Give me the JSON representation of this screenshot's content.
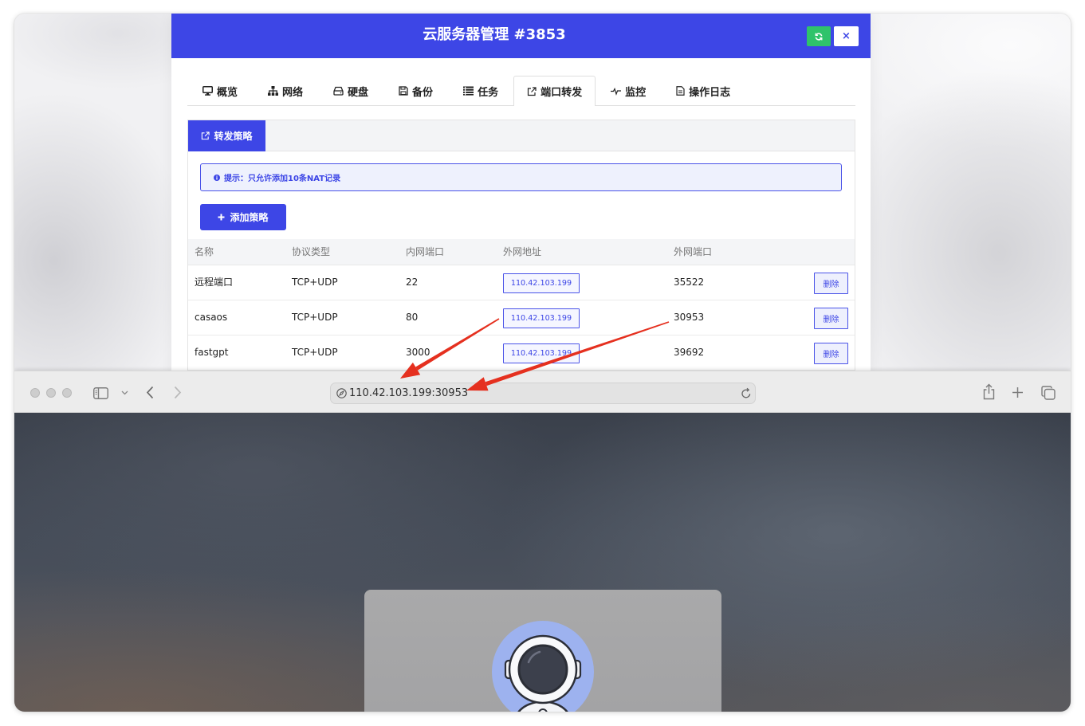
{
  "window": {
    "title": "云服务器管理 #3853",
    "refresh_icon": "refresh-icon",
    "close_label": "×"
  },
  "tabs": [
    {
      "label": "概览",
      "icon": "monitor-icon"
    },
    {
      "label": "网络",
      "icon": "sitemap-icon"
    },
    {
      "label": "硬盘",
      "icon": "hdd-icon"
    },
    {
      "label": "备份",
      "icon": "save-icon"
    },
    {
      "label": "任务",
      "icon": "tasks-icon"
    },
    {
      "label": "端口转发",
      "icon": "external-link-icon",
      "active": true
    },
    {
      "label": "监控",
      "icon": "heartbeat-icon"
    },
    {
      "label": "操作日志",
      "icon": "file-text-icon"
    }
  ],
  "forwarding": {
    "section_tab": {
      "label": "转发策略",
      "icon": "external-link-icon"
    },
    "notice": {
      "icon": "info-icon",
      "text": "提示：只允许添加10条NAT记录"
    },
    "add_button": {
      "icon": "plus-icon",
      "label": "添加策略"
    },
    "table": {
      "columns": [
        "名称",
        "协议类型",
        "内网端口",
        "外网地址",
        "外网端口"
      ],
      "rows": [
        {
          "name": "远程端口",
          "protocol": "TCP+UDP",
          "internal_port": "22",
          "external_address": "110.42.103.199",
          "external_port": "35522",
          "action": "删除"
        },
        {
          "name": "casaos",
          "protocol": "TCP+UDP",
          "internal_port": "80",
          "external_address": "110.42.103.199",
          "external_port": "30953",
          "action": "删除"
        },
        {
          "name": "fastgpt",
          "protocol": "TCP+UDP",
          "internal_port": "3000",
          "external_address": "110.42.103.199",
          "external_port": "39692",
          "action": "删除"
        }
      ]
    }
  },
  "browser": {
    "url": "110.42.103.199:30953",
    "icons": [
      "sidebar-icon",
      "chevron-down-icon",
      "back-icon",
      "forward-icon",
      "compass-icon",
      "reload-icon",
      "share-icon",
      "new-tab-icon",
      "tab-overview-icon"
    ],
    "page_avatar": "astronaut-avatar"
  },
  "colors": {
    "primary": "#3d46e6",
    "refresh_button": "#2fc36b",
    "annotation_arrow": "#e5301f",
    "avatar_bg": "#9db2ef"
  }
}
